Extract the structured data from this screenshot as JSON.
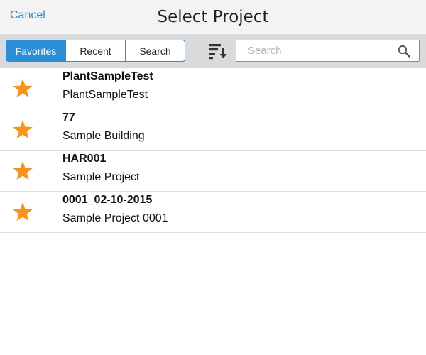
{
  "header": {
    "cancel_label": "Cancel",
    "title": "Select Project"
  },
  "toolbar": {
    "tabs": [
      {
        "label": "Favorites",
        "active": true
      },
      {
        "label": "Recent",
        "active": false
      },
      {
        "label": "Search",
        "active": false
      }
    ],
    "sort_icon": "sort-icon",
    "search": {
      "placeholder": "Search",
      "value": "",
      "icon": "search-icon"
    }
  },
  "projects": [
    {
      "title": "PlantSampleTest",
      "subtitle": "PlantSampleTest",
      "icon": "star-icon",
      "favorite": true
    },
    {
      "title": "77",
      "subtitle": "Sample Building",
      "icon": "star-icon",
      "favorite": true
    },
    {
      "title": "HAR001",
      "subtitle": "Sample Project",
      "icon": "star-icon",
      "favorite": true
    },
    {
      "title": "0001_02-10-2015",
      "subtitle": "Sample Project 0001",
      "icon": "star-icon",
      "favorite": true
    }
  ],
  "colors": {
    "accent": "#2a8fd6",
    "star": "#f7941d",
    "toolbar_bg": "#d9dadb",
    "header_bg": "#f3f3f4"
  }
}
